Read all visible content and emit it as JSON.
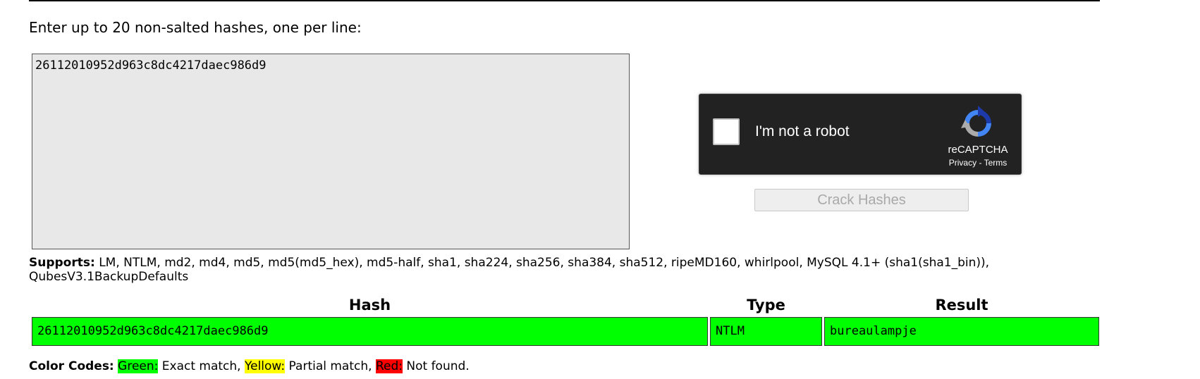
{
  "form": {
    "prompt": "Enter up to 20 non-salted hashes, one per line:",
    "textarea_value": "26112010952d963c8dc4217daec986d9"
  },
  "captcha": {
    "label": "I'm not a robot",
    "brand": "reCAPTCHA",
    "privacy": "Privacy",
    "separator": " - ",
    "terms": "Terms",
    "logo_icon": "recaptcha-logo-icon"
  },
  "button": {
    "crack_label": "Crack Hashes"
  },
  "supports": {
    "label": "Supports:",
    "list": " LM, NTLM, md2, md4, md5, md5(md5_hex), md5-half, sha1, sha224, sha256, sha384, sha512, ripeMD160, whirlpool, MySQL 4.1+ (sha1(sha1_bin)), QubesV3.1BackupDefaults"
  },
  "results": {
    "headers": {
      "hash": "Hash",
      "type": "Type",
      "result": "Result"
    },
    "rows": [
      {
        "hash": "26112010952d963c8dc4217daec986d9",
        "type": "NTLM",
        "result": "bureaulampje",
        "status_color": "#00ff00"
      }
    ]
  },
  "legend": {
    "label": "Color Codes:",
    "green_label": "Green:",
    "green_text": " Exact match, ",
    "yellow_label": "Yellow:",
    "yellow_text": " Partial match, ",
    "red_label": "Red:",
    "red_text": " Not found.",
    "colors": {
      "green": "#00ff00",
      "yellow": "#ffff00",
      "red": "#ff0000"
    }
  }
}
